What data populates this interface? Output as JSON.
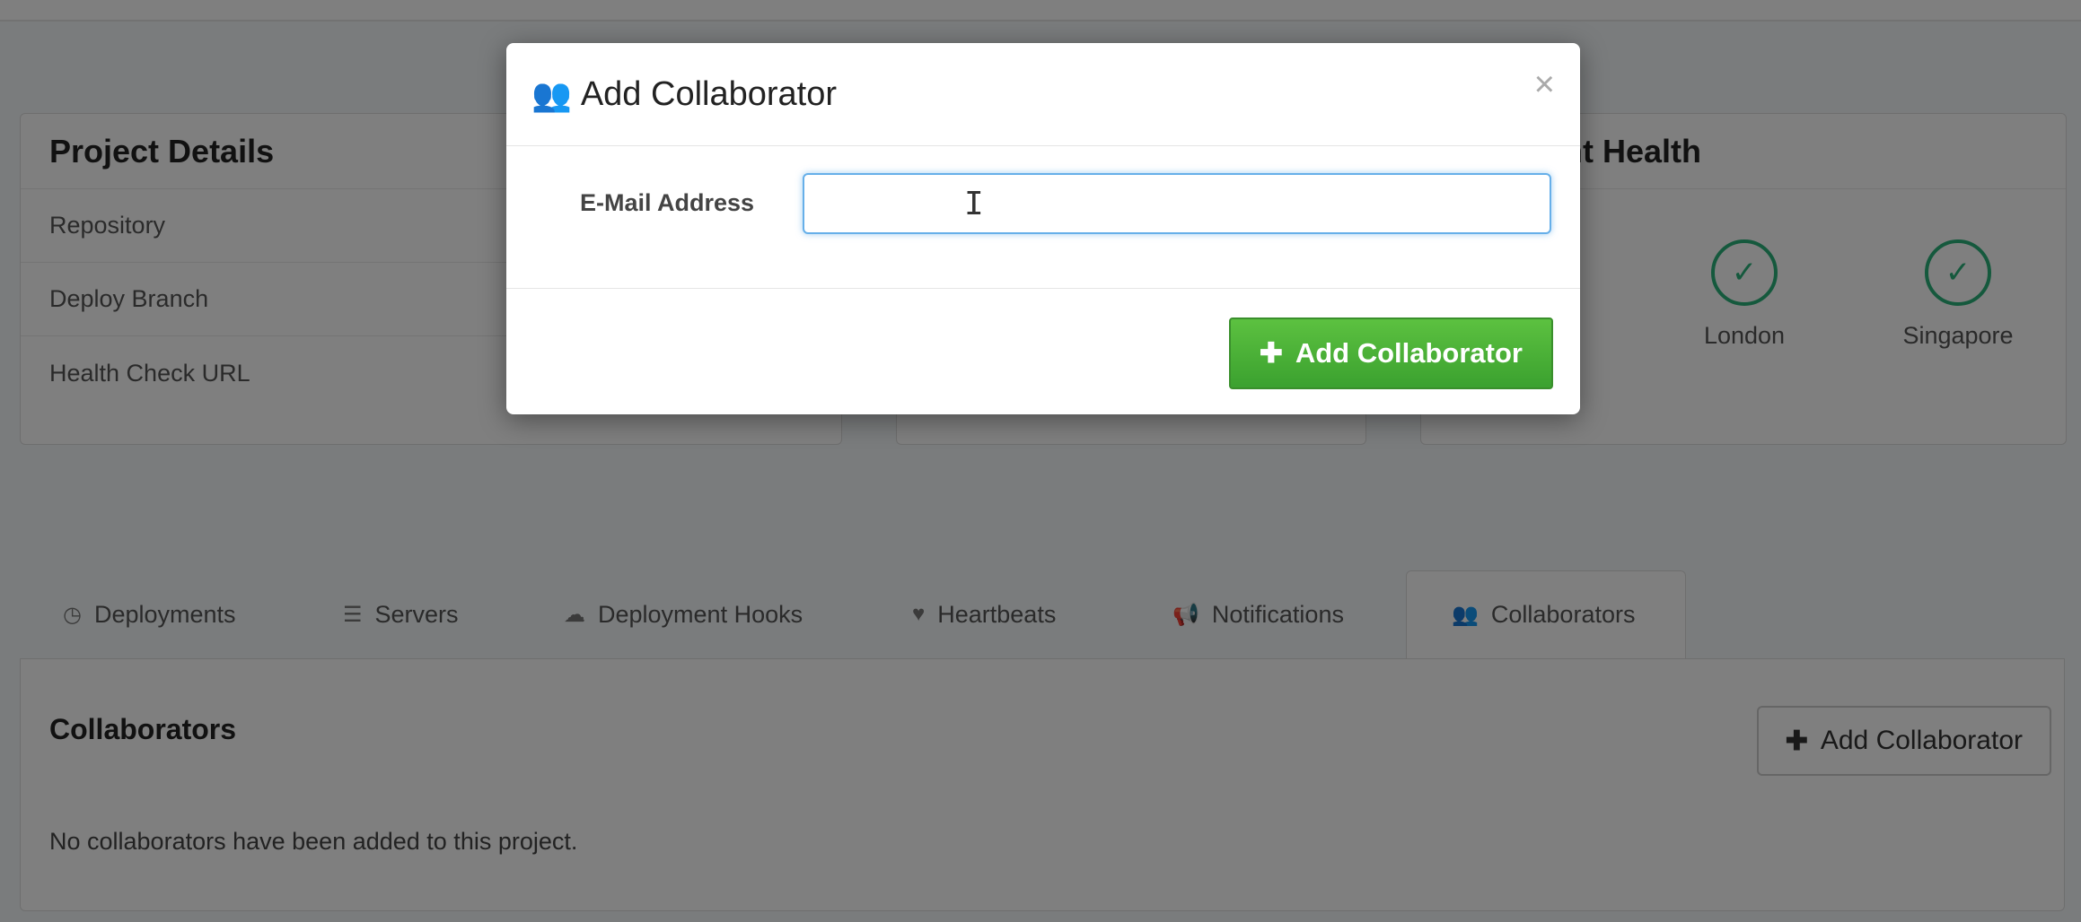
{
  "project_details": {
    "title": "Project Details",
    "rows": [
      "Repository",
      "Deploy Branch",
      "Health Check URL"
    ]
  },
  "deployment_health": {
    "title": "ployment Health",
    "locations": [
      "London",
      "Singapore"
    ]
  },
  "tabs": [
    {
      "label": "Deployments",
      "icon": "clock-icon"
    },
    {
      "label": "Servers",
      "icon": "server-icon"
    },
    {
      "label": "Deployment Hooks",
      "icon": "cloud-icon"
    },
    {
      "label": "Heartbeats",
      "icon": "heart-icon"
    },
    {
      "label": "Notifications",
      "icon": "megaphone-icon"
    },
    {
      "label": "Collaborators",
      "icon": "users-icon"
    }
  ],
  "collaborators": {
    "title": "Collaborators",
    "add_button": "Add Collaborator",
    "empty_message": "No collaborators have been added to this project."
  },
  "modal": {
    "title": "Add Collaborator",
    "close": "×",
    "email_label": "E-Mail Address",
    "email_value": "",
    "submit_button": "Add Collaborator"
  },
  "colors": {
    "success": "#2ab27b",
    "button_green": "#4cae3c",
    "focus_blue": "#66afe9"
  }
}
